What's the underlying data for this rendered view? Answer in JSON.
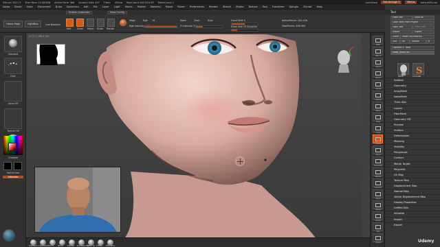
{
  "title_bar": {
    "items": [
      "ZBrush 2021.5",
      "Free Mem 24.384GB",
      "Active Mem 384",
      "Scratch Disk 207",
      "Timer",
      "ATime",
      "PolyCount 162.554 KP",
      "MeshCount 1"
    ],
    "right": {
      "quicksave": "QuickSave",
      "see_through": "See-through 0",
      "menus": "Menus",
      "default_script": "DefaultZScript"
    }
  },
  "menu_bar": {
    "items": [
      "Alpha",
      "Brush",
      "Color",
      "Document",
      "Draw",
      "Dynamics",
      "Edit",
      "File",
      "Layer",
      "Light",
      "Macro",
      "Marker",
      "Material",
      "Movie",
      "Picker",
      "Preferences",
      "Render",
      "Stencil",
      "Stroke",
      "Texture",
      "Tool",
      "Transform",
      "Zplugin",
      "Zscript",
      "Help"
    ]
  },
  "notifications": [
    "Enable Customize",
    "Store Config"
  ],
  "shelf": {
    "home_page": "Home Page",
    "lightbox": "LightBox",
    "live_boolean": "Live Boolean",
    "modes": [
      "Edit",
      "Draw",
      "Move",
      "Scale",
      "Rotate"
    ],
    "mrgb": "Mrgb",
    "rgb": "Rgb",
    "m": "M",
    "zadd": "Zadd",
    "zsub": "Zsub",
    "zcut": "Zcut",
    "rgb_intensity": "Rgb Intensity 100",
    "z_intensity": "Z Intensity 25",
    "focal_shift": "Focal Shift 0",
    "draw_size": "Draw Size 25 Dynamic",
    "active_points": "ActivePoints: 105.426",
    "total_points": "TotalPoints: 206.494",
    "rgb_intensity_value": 1.0,
    "z_intensity_value": 0.25,
    "focal_shift_value": 0.5,
    "draw_size_value": 0.2
  },
  "coords": "0.171 1.196 0.748",
  "left_panel": {
    "brush_label": "Standard",
    "stroke_label": "Dots",
    "alpha_label": "Alpha Off",
    "texture_label": "Texture Off",
    "material_label": "BasicMaterial",
    "gradient_label": "Gradient",
    "switch_color": "SwitchColor",
    "alternate": "Alternate",
    "colors": {
      "main": "#e02020",
      "secondary": "#000000"
    }
  },
  "right_strip": {
    "buttons": [
      "BPR",
      "SPix 3",
      "Scroll",
      "Zoom",
      "Actual",
      "AAHalf",
      "Persp",
      "Floor",
      "Local",
      "Frame",
      "Move",
      "Zoom3D",
      "Rotate",
      "Line Fill",
      "PolyF",
      "Transp",
      "Ghost",
      "Solo",
      "Xpose"
    ]
  },
  "tool_palette": {
    "title": "Tool",
    "buttons": [
      "Load Tool",
      "Save As",
      "Load Tools From Project",
      "Copy Tool",
      "Paste Tool",
      "Import",
      "Export",
      "Clone",
      "Make PolyMesh3D",
      "GoZ",
      "All",
      "Visible",
      "R"
    ],
    "lightbox_tools": "Lightbox > Tools",
    "current_tool": "Head_Guide 48",
    "tool_thumbs": [
      "PM3D",
      "SimpleB"
    ],
    "subpalettes": [
      "Subtool",
      "Geometry",
      "ArrayMesh",
      "NanoMesh",
      "Thick Skin",
      "Layers",
      "FiberMesh",
      "Geometry HD",
      "Preview",
      "Surface",
      "Deformation",
      "Masking",
      "Visibility",
      "Polygroups",
      "Contact",
      "Morph Target",
      "Polypaint",
      "UV Map",
      "Texture Map",
      "Displacement Map",
      "Normal Map",
      "Vector Displacement Map",
      "Display Properties",
      "Unified Skin",
      "Initialize",
      "Import",
      "Export"
    ]
  },
  "bottom_brushes": [
    "Standard",
    "ClayTubes",
    "Pinch",
    "Move",
    "hPolish",
    "DamStandard",
    "Move Tp",
    "Inflate",
    "ZModeler"
  ],
  "watermark": "Udemy"
}
